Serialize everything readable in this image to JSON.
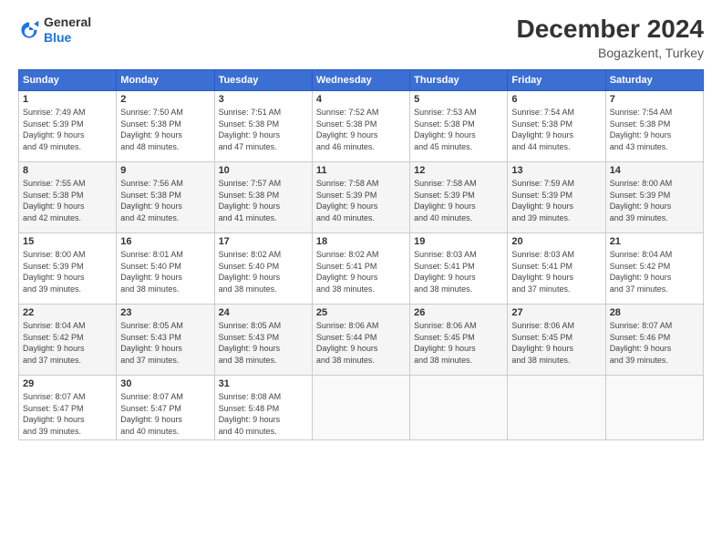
{
  "header": {
    "logo_line1": "General",
    "logo_line2": "Blue",
    "title": "December 2024",
    "location": "Bogazkent, Turkey"
  },
  "columns": [
    "Sunday",
    "Monday",
    "Tuesday",
    "Wednesday",
    "Thursday",
    "Friday",
    "Saturday"
  ],
  "weeks": [
    [
      {
        "day": "1",
        "info": "Sunrise: 7:49 AM\nSunset: 5:39 PM\nDaylight: 9 hours\nand 49 minutes."
      },
      {
        "day": "2",
        "info": "Sunrise: 7:50 AM\nSunset: 5:38 PM\nDaylight: 9 hours\nand 48 minutes."
      },
      {
        "day": "3",
        "info": "Sunrise: 7:51 AM\nSunset: 5:38 PM\nDaylight: 9 hours\nand 47 minutes."
      },
      {
        "day": "4",
        "info": "Sunrise: 7:52 AM\nSunset: 5:38 PM\nDaylight: 9 hours\nand 46 minutes."
      },
      {
        "day": "5",
        "info": "Sunrise: 7:53 AM\nSunset: 5:38 PM\nDaylight: 9 hours\nand 45 minutes."
      },
      {
        "day": "6",
        "info": "Sunrise: 7:54 AM\nSunset: 5:38 PM\nDaylight: 9 hours\nand 44 minutes."
      },
      {
        "day": "7",
        "info": "Sunrise: 7:54 AM\nSunset: 5:38 PM\nDaylight: 9 hours\nand 43 minutes."
      }
    ],
    [
      {
        "day": "8",
        "info": "Sunrise: 7:55 AM\nSunset: 5:38 PM\nDaylight: 9 hours\nand 42 minutes."
      },
      {
        "day": "9",
        "info": "Sunrise: 7:56 AM\nSunset: 5:38 PM\nDaylight: 9 hours\nand 42 minutes."
      },
      {
        "day": "10",
        "info": "Sunrise: 7:57 AM\nSunset: 5:38 PM\nDaylight: 9 hours\nand 41 minutes."
      },
      {
        "day": "11",
        "info": "Sunrise: 7:58 AM\nSunset: 5:39 PM\nDaylight: 9 hours\nand 40 minutes."
      },
      {
        "day": "12",
        "info": "Sunrise: 7:58 AM\nSunset: 5:39 PM\nDaylight: 9 hours\nand 40 minutes."
      },
      {
        "day": "13",
        "info": "Sunrise: 7:59 AM\nSunset: 5:39 PM\nDaylight: 9 hours\nand 39 minutes."
      },
      {
        "day": "14",
        "info": "Sunrise: 8:00 AM\nSunset: 5:39 PM\nDaylight: 9 hours\nand 39 minutes."
      }
    ],
    [
      {
        "day": "15",
        "info": "Sunrise: 8:00 AM\nSunset: 5:39 PM\nDaylight: 9 hours\nand 39 minutes."
      },
      {
        "day": "16",
        "info": "Sunrise: 8:01 AM\nSunset: 5:40 PM\nDaylight: 9 hours\nand 38 minutes."
      },
      {
        "day": "17",
        "info": "Sunrise: 8:02 AM\nSunset: 5:40 PM\nDaylight: 9 hours\nand 38 minutes."
      },
      {
        "day": "18",
        "info": "Sunrise: 8:02 AM\nSunset: 5:41 PM\nDaylight: 9 hours\nand 38 minutes."
      },
      {
        "day": "19",
        "info": "Sunrise: 8:03 AM\nSunset: 5:41 PM\nDaylight: 9 hours\nand 38 minutes."
      },
      {
        "day": "20",
        "info": "Sunrise: 8:03 AM\nSunset: 5:41 PM\nDaylight: 9 hours\nand 37 minutes."
      },
      {
        "day": "21",
        "info": "Sunrise: 8:04 AM\nSunset: 5:42 PM\nDaylight: 9 hours\nand 37 minutes."
      }
    ],
    [
      {
        "day": "22",
        "info": "Sunrise: 8:04 AM\nSunset: 5:42 PM\nDaylight: 9 hours\nand 37 minutes."
      },
      {
        "day": "23",
        "info": "Sunrise: 8:05 AM\nSunset: 5:43 PM\nDaylight: 9 hours\nand 37 minutes."
      },
      {
        "day": "24",
        "info": "Sunrise: 8:05 AM\nSunset: 5:43 PM\nDaylight: 9 hours\nand 38 minutes."
      },
      {
        "day": "25",
        "info": "Sunrise: 8:06 AM\nSunset: 5:44 PM\nDaylight: 9 hours\nand 38 minutes."
      },
      {
        "day": "26",
        "info": "Sunrise: 8:06 AM\nSunset: 5:45 PM\nDaylight: 9 hours\nand 38 minutes."
      },
      {
        "day": "27",
        "info": "Sunrise: 8:06 AM\nSunset: 5:45 PM\nDaylight: 9 hours\nand 38 minutes."
      },
      {
        "day": "28",
        "info": "Sunrise: 8:07 AM\nSunset: 5:46 PM\nDaylight: 9 hours\nand 39 minutes."
      }
    ],
    [
      {
        "day": "29",
        "info": "Sunrise: 8:07 AM\nSunset: 5:47 PM\nDaylight: 9 hours\nand 39 minutes."
      },
      {
        "day": "30",
        "info": "Sunrise: 8:07 AM\nSunset: 5:47 PM\nDaylight: 9 hours\nand 40 minutes."
      },
      {
        "day": "31",
        "info": "Sunrise: 8:08 AM\nSunset: 5:48 PM\nDaylight: 9 hours\nand 40 minutes."
      },
      {
        "day": "",
        "info": ""
      },
      {
        "day": "",
        "info": ""
      },
      {
        "day": "",
        "info": ""
      },
      {
        "day": "",
        "info": ""
      }
    ]
  ]
}
